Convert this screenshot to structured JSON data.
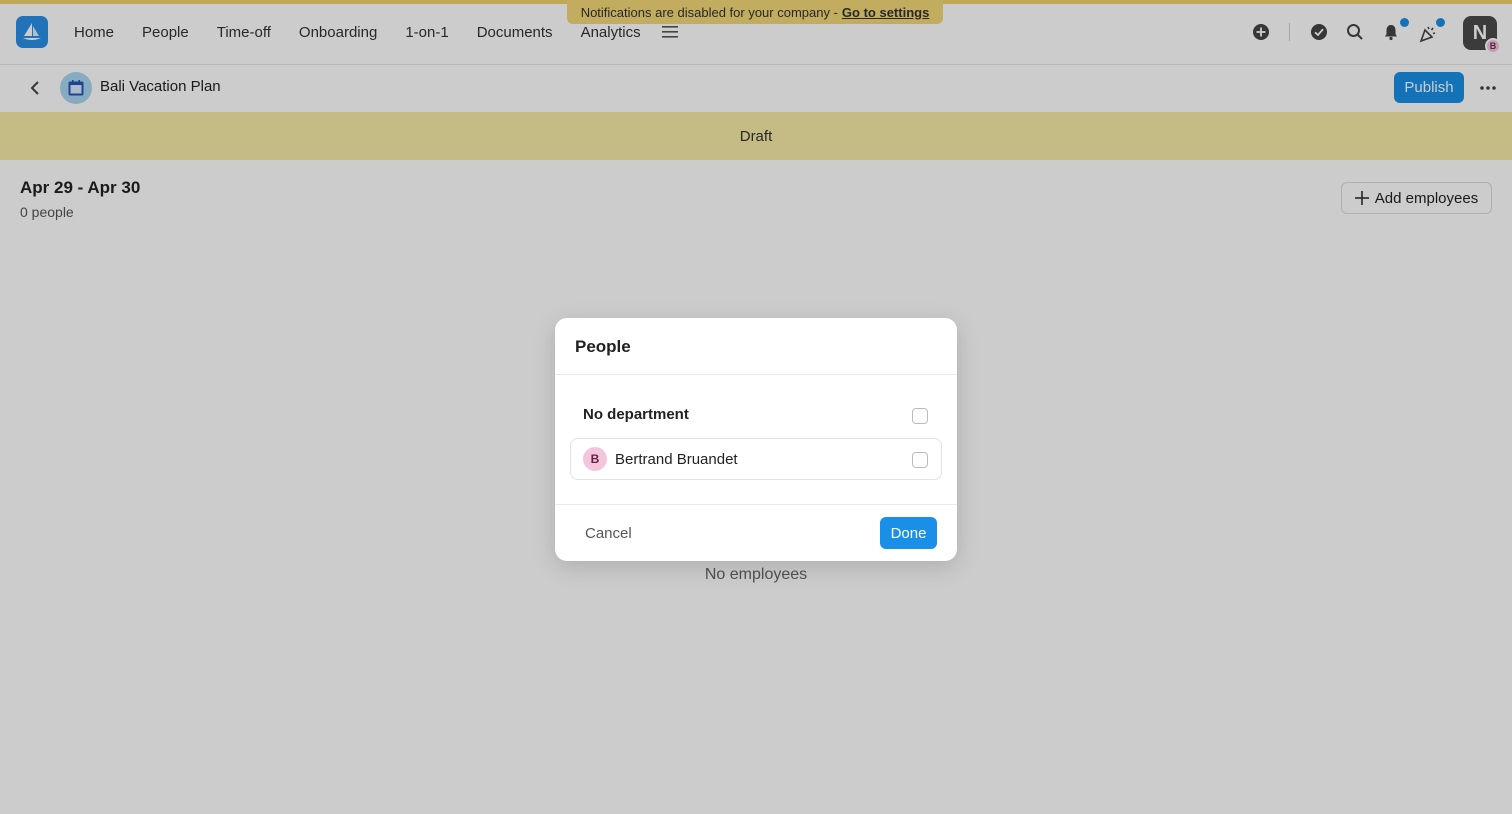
{
  "notification_banner": {
    "text": "Notifications are disabled for your company -",
    "link": "Go to settings"
  },
  "nav": {
    "items": [
      "Home",
      "People",
      "Time-off",
      "Onboarding",
      "1-on-1",
      "Documents",
      "Analytics"
    ]
  },
  "user": {
    "initial": "N",
    "sub_initial": "B"
  },
  "plan": {
    "title": "Bali Vacation Plan",
    "publish_label": "Publish",
    "status": "Draft",
    "date_range": "Apr 29 - Apr 30",
    "people_count": "0 people",
    "add_employees_label": "Add employees",
    "empty_label": "No employees"
  },
  "modal": {
    "title": "People",
    "department_label": "No department",
    "person": {
      "initial": "B",
      "name": "Bertrand Bruandet",
      "checked": false
    },
    "department_checked": false,
    "cancel_label": "Cancel",
    "done_label": "Done"
  },
  "colors": {
    "accent": "#1a8fe8",
    "draft_banner": "#f6eba6",
    "notification_banner": "#f3d878",
    "badge": "#1a8fe8"
  }
}
